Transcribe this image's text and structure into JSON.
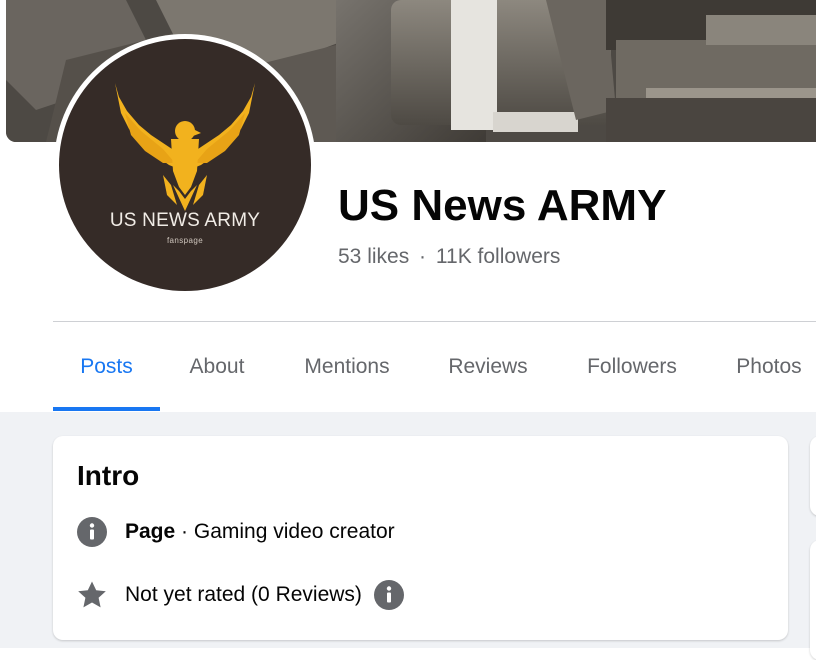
{
  "profile": {
    "name": "US News ARMY",
    "likes": "53 likes",
    "separator": "·",
    "followers": "11K followers",
    "logo_title": "US NEWS ARMY",
    "logo_subtitle": "fanspage"
  },
  "tabs": [
    {
      "label": "Posts",
      "active": true
    },
    {
      "label": "About"
    },
    {
      "label": "Mentions"
    },
    {
      "label": "Reviews"
    },
    {
      "label": "Followers"
    },
    {
      "label": "Photos"
    }
  ],
  "intro": {
    "title": "Intro",
    "category_prefix": "Page",
    "category_text": " · Gaming video creator",
    "rating": "Not yet rated (0 Reviews)"
  },
  "colors": {
    "accent": "#1877f2",
    "secondary_text": "#65676b",
    "eagle_gold": "#f2b21e",
    "avatar_bg": "#352b27",
    "icon_gray": "#65676b"
  },
  "icons": {
    "info": "info-icon",
    "star": "star-icon",
    "eagle": "eagle-logo"
  }
}
